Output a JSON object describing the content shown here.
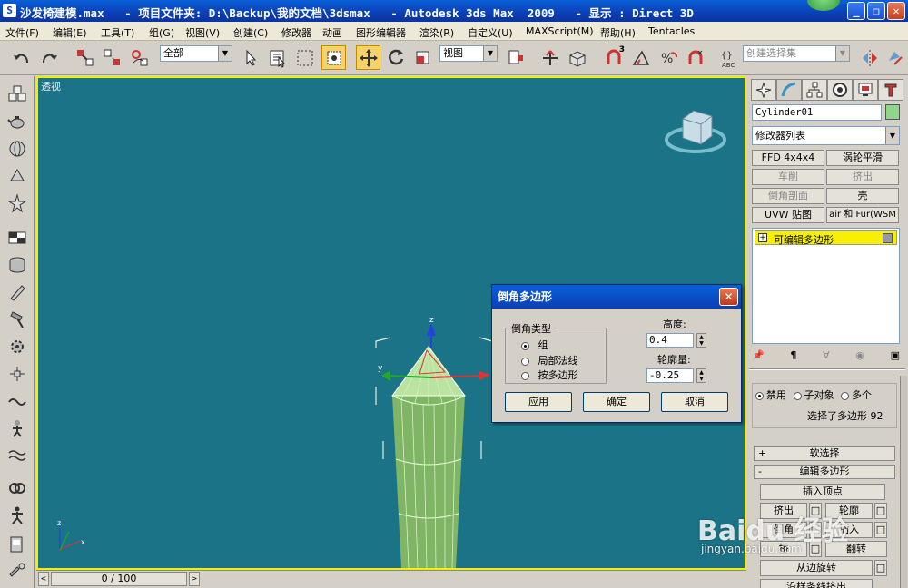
{
  "title": {
    "text": "沙发椅建模.max   - 项目文件夹: D:\\Backup\\我的文档\\3dsmax   - Autodesk 3ds Max  2009   - 显示 : Direct 3D"
  },
  "menu": [
    "文件(F)",
    "编辑(E)",
    "工具(T)",
    "组(G)",
    "视图(V)",
    "创建(C)",
    "修改器",
    "动画",
    "图形编辑器",
    "渲染(R)",
    "自定义(U)",
    "MAXScript(M)",
    "帮助(H)",
    "Tentacles"
  ],
  "toolbar": {
    "selection_filter": "全部",
    "ref_coord": "视图",
    "named_selection_placeholder": "创建选择集",
    "angle_snap_label": "3"
  },
  "viewport": {
    "label": "透视",
    "gizmo_axis_x": "x",
    "gizmo_axis_y": "y",
    "gizmo_axis_z": "z"
  },
  "dialog": {
    "title": "倒角多边形",
    "group_title": "倒角类型",
    "options": [
      "组",
      "局部法线",
      "按多边形"
    ],
    "selected_option": "组",
    "height_label": "高度:",
    "height_value": "0.4",
    "outline_label": "轮廓量:",
    "outline_value": "-0.25",
    "apply": "应用",
    "ok": "确定",
    "cancel": "取消"
  },
  "command_panel": {
    "object_name": "Cylinder01",
    "object_color": "#8ed68a",
    "modifier_list": "修改器列表",
    "modifier_buttons": [
      {
        "label": "FFD 4x4x4",
        "enabled": true
      },
      {
        "label": "涡轮平滑",
        "enabled": true
      },
      {
        "label": "车削",
        "enabled": false
      },
      {
        "label": "挤出",
        "enabled": false
      },
      {
        "label": "倒角剖面",
        "enabled": false
      },
      {
        "label": "壳",
        "enabled": true
      },
      {
        "label": "UVW 贴图",
        "enabled": true
      },
      {
        "label": "air 和 Fur(WSM",
        "enabled": true
      }
    ],
    "stack_item": "可编辑多边形",
    "preview_options": [
      "禁用",
      "子对象",
      "多个"
    ],
    "selection_info": "选择了多边形 92",
    "rollouts": [
      "软选择",
      "编辑多边形"
    ],
    "insert_vertex": "插入顶点",
    "edit_buttons": [
      "挤出",
      "轮廓",
      "倒角",
      "插入",
      "桥",
      "翻转"
    ],
    "hinge": "从边旋转",
    "extrude_along_spline": "沿样条线挤出"
  },
  "timeline": {
    "frame": "0 / 100"
  },
  "watermark": {
    "brand": "Baidu 经验",
    "url": "jingyan.baidu.com"
  },
  "colors": {
    "viewport_bg": "#1a7386",
    "active_border": "#f0f000",
    "title_bar": "#0b3fb5",
    "object_green": "#8ed68a",
    "stack_highlight": "#f8f000"
  }
}
